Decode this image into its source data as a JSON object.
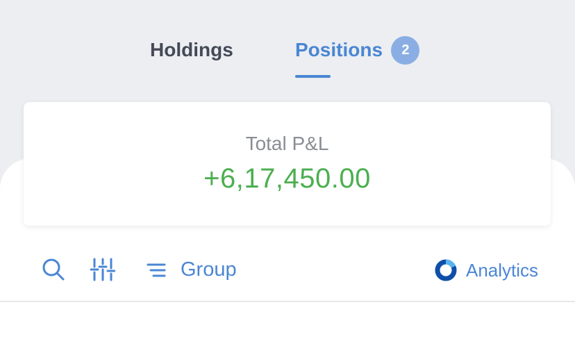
{
  "tabs": {
    "holdings_label": "Holdings",
    "positions_label": "Positions",
    "positions_badge": "2",
    "active": "Positions"
  },
  "pnl": {
    "label": "Total P&L",
    "value": "+6,17,450.00",
    "value_color": "#4caf50"
  },
  "toolbar": {
    "search_icon": "search-icon",
    "filter_icon": "sliders-icon",
    "group_icon": "group-lines-icon",
    "group_label": "Group",
    "analytics_icon": "analytics-ring-icon",
    "analytics_label": "Analytics"
  },
  "colors": {
    "accent": "#4a86d4",
    "badge": "#8aaee4",
    "background": "#eceef1"
  }
}
